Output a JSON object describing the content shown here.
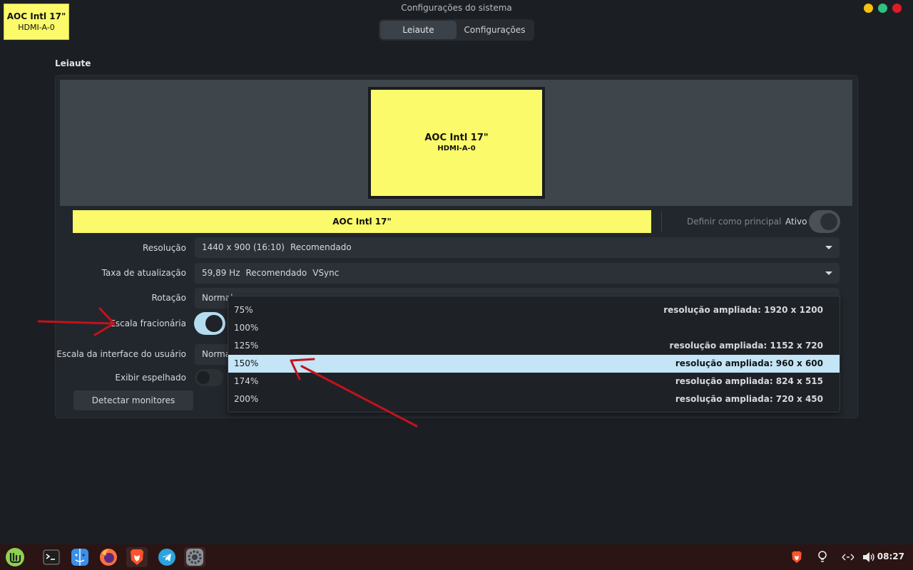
{
  "window": {
    "title": "Configurações do sistema",
    "controls": {
      "minimize_color": "#f5c211",
      "maximize_color": "#2ec27e",
      "close_color": "#e01b24"
    }
  },
  "identify_badge": {
    "name": "AOC Intl 17\"",
    "connector": "HDMI-A-0"
  },
  "stack": {
    "tabs": [
      {
        "label": "Leiaute",
        "active": true
      },
      {
        "label": "Configurações",
        "active": false
      }
    ]
  },
  "section": {
    "title": "Leiaute"
  },
  "preview": {
    "monitor_name": "AOC Intl 17\"",
    "monitor_connector": "HDMI-A-0"
  },
  "monitor_bar": {
    "name": "AOC Intl 17\"",
    "set_primary_label": "Definir como principal",
    "active_label": "Ativo",
    "active_on": true
  },
  "settings": {
    "resolution": {
      "label": "Resolução",
      "value": "1440 x 900 (16:10)",
      "note": "Recomendado"
    },
    "refresh": {
      "label": "Taxa de atualização",
      "value": "59,89 Hz",
      "note": "Recomendado",
      "extra": "VSync"
    },
    "rotation": {
      "label": "Rotação",
      "value": "Normal"
    },
    "fractional": {
      "label": "Escala fracionária",
      "on": true
    },
    "ui_scale": {
      "label": "Escala da interface do usuário",
      "value": "Normal"
    },
    "mirror": {
      "label": "Exibir espelhado",
      "on": false
    },
    "detect_label": "Detectar monitores"
  },
  "scale_dropdown": {
    "selected": "150%",
    "options": [
      {
        "value": "75%",
        "hint": "resolução ampliada: 1920 x 1200"
      },
      {
        "value": "100%",
        "hint": ""
      },
      {
        "value": "125%",
        "hint": "resolução ampliada: 1152 x 720"
      },
      {
        "value": "150%",
        "hint": "resolução ampliada: 960 x 600"
      },
      {
        "value": "174%",
        "hint": "resolução ampliada: 824 x 515"
      },
      {
        "value": "200%",
        "hint": "resolução ampliada: 720 x 450"
      }
    ]
  },
  "colors": {
    "accent": "#b5dcef",
    "monitor_yellow": "#fbfa6a",
    "annotation_red": "#c4121c"
  },
  "taskbar": {
    "apps": [
      {
        "icon": "linux-mint-menu-icon"
      },
      {
        "icon": "terminal-icon"
      },
      {
        "icon": "file-manager-icon"
      },
      {
        "icon": "firefox-icon"
      },
      {
        "icon": "brave-browser-icon"
      },
      {
        "icon": "telegram-icon"
      },
      {
        "icon": "system-settings-icon"
      }
    ],
    "tray": [
      "brave-tray-icon",
      "location-icon",
      "network-icon",
      "volume-icon"
    ],
    "clock": "08:27"
  }
}
